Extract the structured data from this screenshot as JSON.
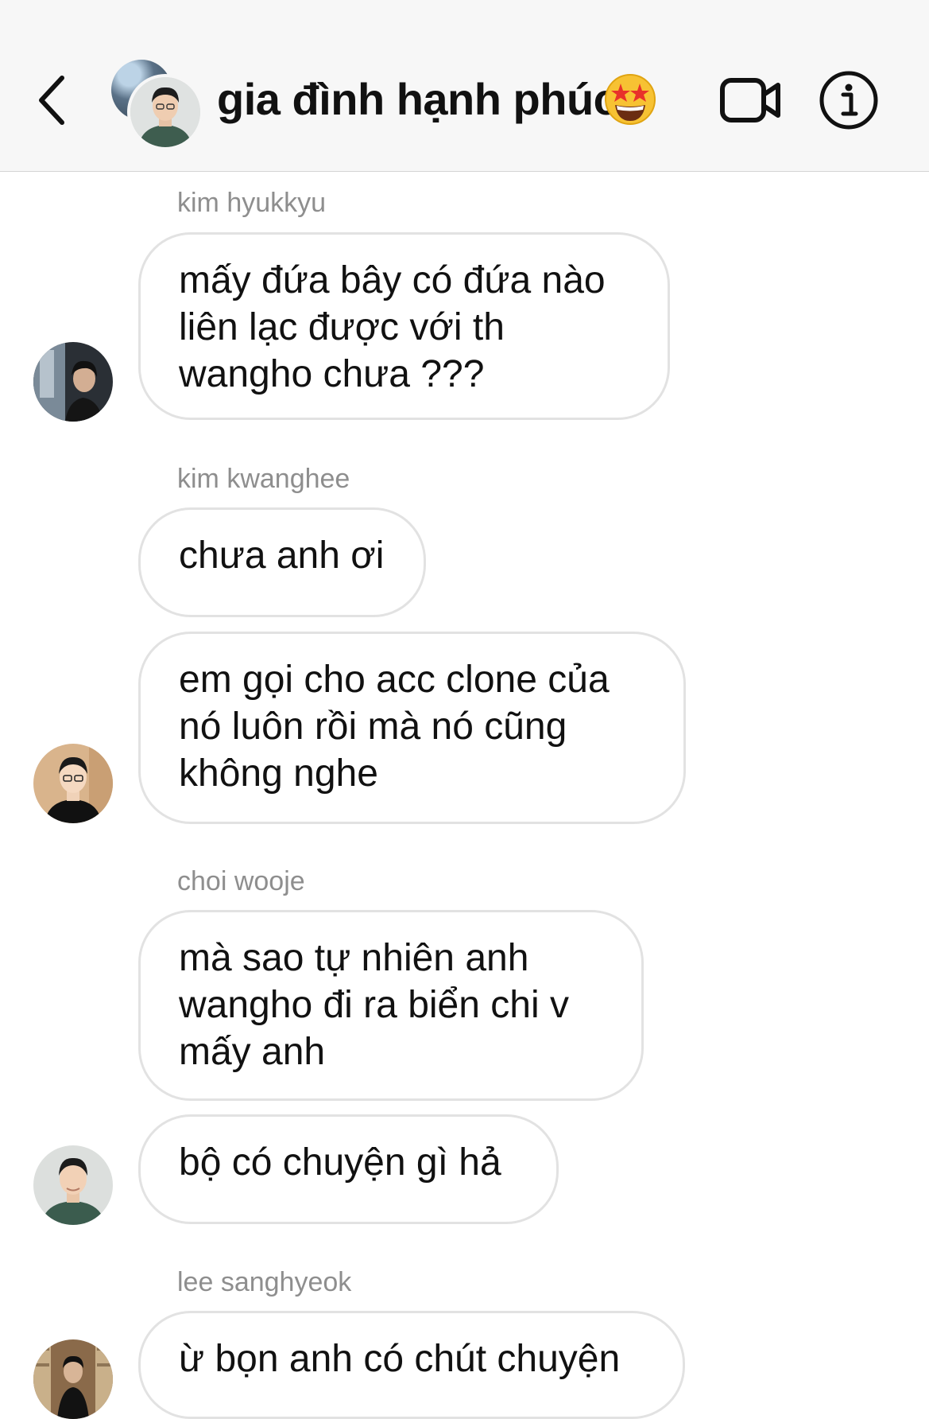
{
  "header": {
    "title": "gia đình hạnh phúc",
    "title_emoji": "🤩",
    "back_icon": "chevron-left-icon",
    "video_icon": "video-camera-icon",
    "info_icon": "info-icon"
  },
  "messages": [
    {
      "sender": "kim hyukkyu",
      "lines": [
        "mấy đứa bây có đứa nào",
        "liên lạc được với th",
        "wangho chưa ???"
      ]
    },
    {
      "sender": "kim kwanghee",
      "lines": [
        "chưa anh ơi"
      ]
    },
    {
      "sender": "",
      "lines": [
        "em gọi cho acc clone của",
        "nó luôn rồi mà nó cũng",
        "không nghe"
      ]
    },
    {
      "sender": "choi wooje",
      "lines": [
        "mà sao tự nhiên anh",
        "wangho đi ra biển chi v",
        "mấy anh"
      ]
    },
    {
      "sender": "",
      "lines": [
        "bộ có chuyện gì hả"
      ]
    },
    {
      "sender": "lee sanghyeok",
      "lines": [
        "ừ bọn anh có chút chuyện"
      ]
    }
  ],
  "colors": {
    "header_bg": "#f7f7f7",
    "bubble_border": "#e2e2e2",
    "sender_text": "#8e8e8e",
    "text": "#111111"
  }
}
